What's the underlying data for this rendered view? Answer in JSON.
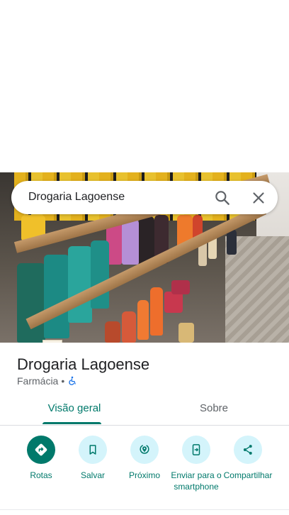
{
  "search": {
    "query": "Drogaria Lagoense",
    "search_icon": "search-icon",
    "close_icon": "close-icon"
  },
  "place": {
    "name": "Drogaria Lagoense",
    "category": "Farmácia",
    "separator": "•",
    "accessibility_icon": "wheelchair-icon"
  },
  "tabs": [
    {
      "label": "Visão geral",
      "active": true
    },
    {
      "label": "Sobre",
      "active": false
    }
  ],
  "actions": [
    {
      "label": "Rotas",
      "icon": "directions-icon"
    },
    {
      "label": "Salvar",
      "icon": "bookmark-icon"
    },
    {
      "label": "Próximo",
      "icon": "nearby-icon"
    },
    {
      "label": "Enviar para o smartphone",
      "icon": "send-to-phone-icon"
    },
    {
      "label": "Compartilhar",
      "icon": "share-icon"
    }
  ],
  "colors": {
    "accent": "#00796b",
    "action_bg": "#d4f4fb",
    "accessibility_icon": "#1a73e8",
    "text_primary": "#202124",
    "text_secondary": "#5f6368"
  }
}
